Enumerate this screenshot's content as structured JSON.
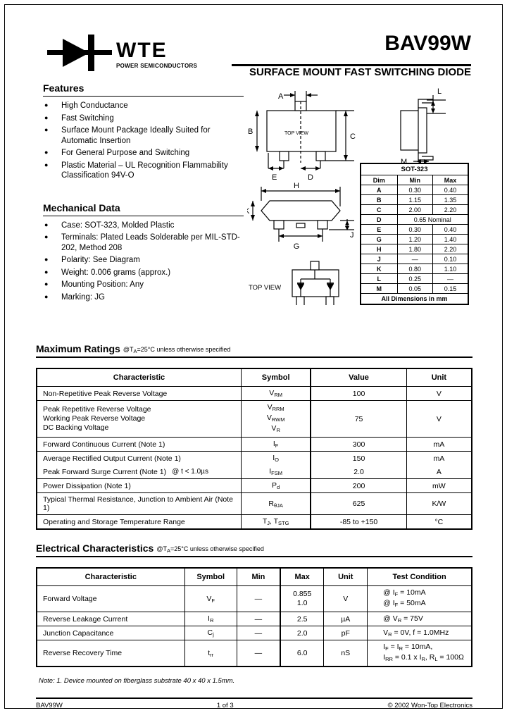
{
  "header": {
    "logo_name": "WTE",
    "logo_tagline": "POWER SEMICONDUCTORS",
    "part_number": "BAV99W",
    "subtitle": "SURFACE MOUNT FAST SWITCHING DIODE"
  },
  "features": {
    "title": "Features",
    "items": [
      "High Conductance",
      "Fast Switching",
      "Surface Mount Package Ideally Suited for Automatic Insertion",
      "For General Purpose and Switching",
      "Plastic Material – UL Recognition Flammability Classification 94V-O"
    ]
  },
  "mechanical": {
    "title": "Mechanical Data",
    "items": [
      "Case: SOT-323, Molded Plastic",
      "Terminals: Plated Leads Solderable per MIL-STD-202, Method 208",
      "Polarity: See Diagram",
      "Weight: 0.006 grams (approx.)",
      "Mounting Position: Any",
      "Marking: JG"
    ]
  },
  "package_drawing": {
    "top_view_label": "TOP VIEW",
    "schematic_label": "TOP VIEW",
    "dim_labels": [
      "A",
      "B",
      "C",
      "D",
      "E",
      "G",
      "H",
      "J",
      "K",
      "L",
      "M"
    ]
  },
  "dim_table": {
    "package": "SOT-323",
    "headers": [
      "Dim",
      "Min",
      "Max"
    ],
    "rows": [
      {
        "dim": "A",
        "min": "0.30",
        "max": "0.40"
      },
      {
        "dim": "B",
        "min": "1.15",
        "max": "1.35"
      },
      {
        "dim": "C",
        "min": "2.00",
        "max": "2.20"
      },
      {
        "dim": "D",
        "span": "0.65 Nominal"
      },
      {
        "dim": "E",
        "min": "0.30",
        "max": "0.40"
      },
      {
        "dim": "G",
        "min": "1.20",
        "max": "1.40"
      },
      {
        "dim": "H",
        "min": "1.80",
        "max": "2.20"
      },
      {
        "dim": "J",
        "min": "—",
        "max": "0.10"
      },
      {
        "dim": "K",
        "min": "0.80",
        "max": "1.10"
      },
      {
        "dim": "L",
        "min": "0.25",
        "max": "—"
      },
      {
        "dim": "M",
        "min": "0.05",
        "max": "0.15"
      }
    ],
    "footer": "All Dimensions in mm"
  },
  "max_ratings": {
    "title": "Maximum Ratings",
    "condition": "@TA=25°C unless otherwise specified",
    "condition_prefix": "@T",
    "condition_sub": "A",
    "condition_suffix": "=25°C unless otherwise specified",
    "headers": [
      "Characteristic",
      "Symbol",
      "Value",
      "Unit"
    ],
    "rows": [
      {
        "characteristic": "Non-Repetitive Peak Reverse Voltage",
        "symbol": "VRM",
        "sym_base": "V",
        "sym_sub": "RM",
        "value": "100",
        "unit": "V"
      },
      {
        "characteristic": "Peak Repetitive Reverse Voltage\nWorking Peak Reverse Voltage\nDC Backing Voltage",
        "symbol": "VRRM / VRWM / VR",
        "value": "75",
        "unit": "V"
      },
      {
        "characteristic": "Forward Continuous Current (Note 1)",
        "symbol": "IF",
        "sym_base": "I",
        "sym_sub": "F",
        "value": "300",
        "unit": "mA"
      },
      {
        "characteristic": "Average Rectified Output Current (Note 1)",
        "symbol": "IO",
        "sym_base": "I",
        "sym_sub": "O",
        "value": "150",
        "unit": "mA"
      },
      {
        "characteristic": "Peak Forward Surge Current (Note 1)",
        "extra": "@ t < 1.0µs",
        "symbol": "IFSM",
        "sym_base": "I",
        "sym_sub": "FSM",
        "value": "2.0",
        "unit": "A"
      },
      {
        "characteristic": "Power Dissipation (Note 1)",
        "symbol": "Pd",
        "sym_base": "P",
        "sym_sub": "d",
        "value": "200",
        "unit": "mW"
      },
      {
        "characteristic": "Typical Thermal Resistance, Junction to Ambient Air (Note 1)",
        "symbol": "RθJA",
        "sym_base": "R",
        "sym_sub": "θJA",
        "value": "625",
        "unit": "K/W"
      },
      {
        "characteristic": "Operating and Storage Temperature Range",
        "symbol": "TJ, TSTG",
        "value": "-85 to +150",
        "unit": "°C"
      }
    ]
  },
  "electrical": {
    "title": "Electrical Characteristics",
    "condition_prefix": "@T",
    "condition_sub": "A",
    "condition_suffix": "=25°C unless otherwise specified",
    "headers": [
      "Characteristic",
      "Symbol",
      "Min",
      "Max",
      "Unit",
      "Test Condition"
    ],
    "rows": [
      {
        "characteristic": "Forward Voltage",
        "sym_base": "V",
        "sym_sub": "F",
        "min": "—",
        "max": "0.855\n1.0",
        "max_line1": "0.855",
        "max_line2": "1.0",
        "unit": "V",
        "cond_line1": "@ IF = 10mA",
        "cond_line2": "@ IF = 50mA"
      },
      {
        "characteristic": "Reverse Leakage Current",
        "sym_base": "I",
        "sym_sub": "R",
        "min": "—",
        "max": "2.5",
        "unit": "µA",
        "cond_line1": "@ VR = 75V",
        "cond_line2": ""
      },
      {
        "characteristic": "Junction Capacitance",
        "sym_base": "C",
        "sym_sub": "j",
        "min": "—",
        "max": "2.0",
        "unit": "pF",
        "cond_line1": "VR = 0V, f = 1.0MHz",
        "cond_line2": ""
      },
      {
        "characteristic": "Reverse Recovery Time",
        "sym_base": "t",
        "sym_sub": "rr",
        "min": "—",
        "max": "6.0",
        "unit": "nS",
        "cond_line1": "IF = IR = 10mA,",
        "cond_line2": "IRR = 0.1 x IR, RL = 100Ω"
      }
    ]
  },
  "note": "Note:  1. Device mounted on fiberglass substrate 40 x 40 x 1.5mm.",
  "footer": {
    "part": "BAV99W",
    "page": "1 of 3",
    "copyright": "© 2002 Won-Top Electronics"
  }
}
